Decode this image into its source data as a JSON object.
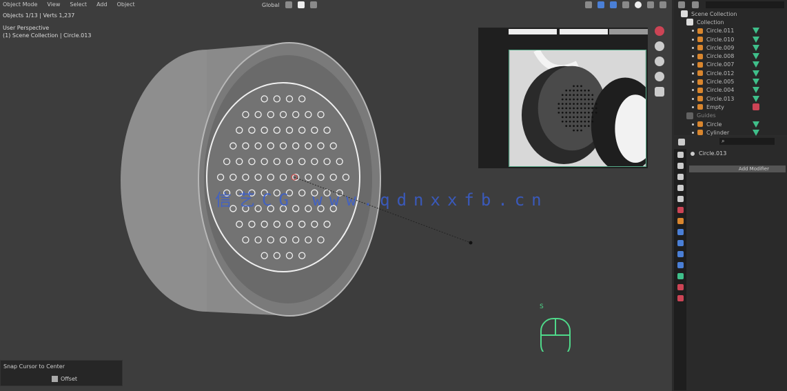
{
  "header": {
    "menu": [
      "Object Mode",
      "View",
      "Select",
      "Add",
      "Object"
    ],
    "shading_mode": "Global",
    "stats": "Objects 1/13 | Verts 1,237"
  },
  "overlay": {
    "view_name": "User Perspective",
    "collection_info": "(1) Scene Collection | Circle.013"
  },
  "watermark": "信艺CG www.qdnxxfb.cn",
  "redo_panel": {
    "title": "Snap Cursor to Center",
    "option": "Offset"
  },
  "key_hint": {
    "key": "S",
    "icon": "mouse-icon"
  },
  "outliner": {
    "root": "Scene Collection",
    "collection": "Collection",
    "items": [
      "Circle.011",
      "Circle.010",
      "Circle.009",
      "Circle.008",
      "Circle.007",
      "Circle.012",
      "Circle.005",
      "Circle.004",
      "Circle.013",
      "Empty"
    ],
    "collection2": "Guides",
    "items2": [
      "Circle",
      "Cylinder"
    ]
  },
  "properties": {
    "search_placeholder": "",
    "object_name": "Circle.013",
    "add_modifier": "Add Modifier"
  },
  "colors": {
    "viewport": "#3d3d3d",
    "mesh_icon": "#d9862e",
    "modifier_icon": "#3fbf8a",
    "hint": "#4fd98a",
    "watermark": "#3a5fd0"
  }
}
